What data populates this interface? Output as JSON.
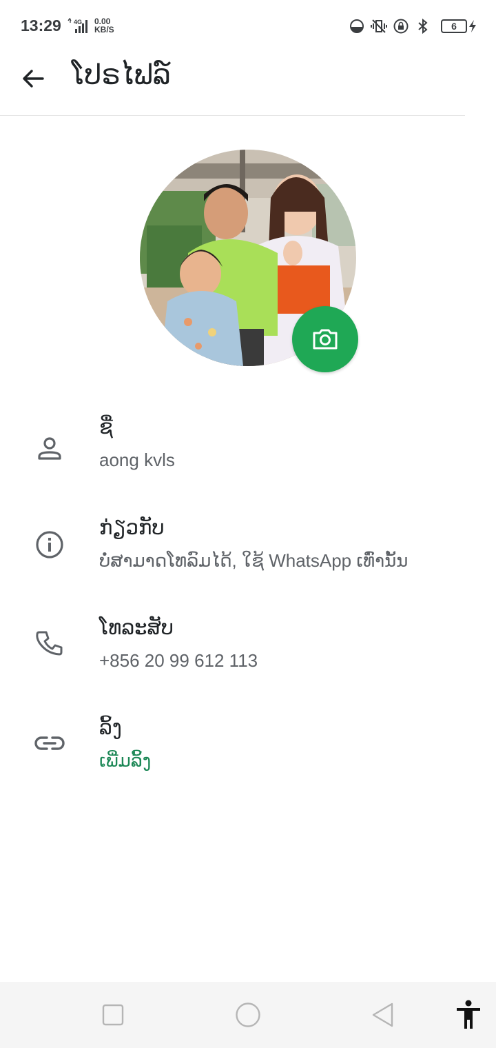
{
  "status_bar": {
    "time": "13:29",
    "network": "4G",
    "speed_value": "0.00",
    "speed_unit": "KB/S",
    "battery": "6",
    "icons": [
      "data-saver-icon",
      "vibrate-icon",
      "rotation-lock-icon",
      "bluetooth-icon",
      "battery-icon",
      "charging-icon"
    ]
  },
  "app_bar": {
    "title": "ໂປຣໄຟລ໌",
    "back_icon": "arrow-back-icon"
  },
  "profile": {
    "camera_icon": "camera-icon",
    "accent_color": "#1fa855"
  },
  "rows": [
    {
      "icon": "person-icon",
      "label": "ຊື່",
      "value": "aong kvls"
    },
    {
      "icon": "info-icon",
      "label": "ກ່ຽວກັບ",
      "value": "ບໍ່ສາມາດໂທລົມໄດ້, ໃຊ້ WhatsApp ເທົ່ານັ້ນ"
    },
    {
      "icon": "phone-icon",
      "label": "ໂທລະສັບ",
      "value": "+856 20 99 612 113"
    },
    {
      "icon": "link-icon",
      "label": "ລິ້ງ",
      "value": "ເພີ່ມລິ້ງ"
    }
  ],
  "nav_bar": {
    "buttons": [
      "recents-button",
      "home-button",
      "back-button",
      "accessibility-button"
    ]
  }
}
